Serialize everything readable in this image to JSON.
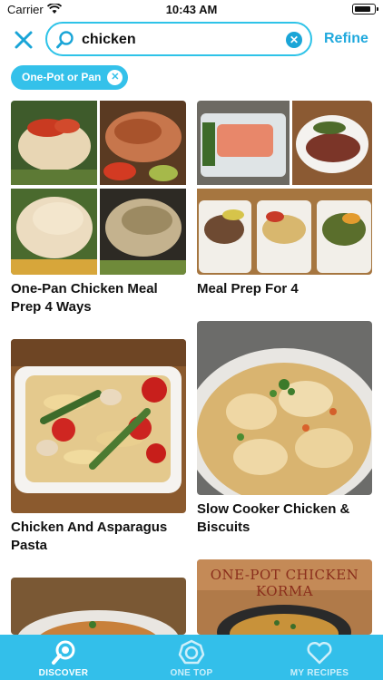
{
  "status_bar": {
    "carrier": "Carrier",
    "time": "10:43 AM"
  },
  "search": {
    "query": "chicken",
    "refine_label": "Refine"
  },
  "filter_chip": {
    "label": "One-Pot or Pan"
  },
  "recipes": [
    {
      "title": "One-Pan Chicken Meal Prep 4 Ways"
    },
    {
      "title": "Meal Prep For 4"
    },
    {
      "title": "Chicken And Asparagus Pasta"
    },
    {
      "title": "Slow Cooker Chicken & Biscuits"
    },
    {
      "title": ""
    },
    {
      "title": ""
    }
  ],
  "korma_banner_text": "ONE-POT CHICKEN KORMA",
  "tabs": [
    {
      "label": "DISCOVER",
      "icon": "discover-icon"
    },
    {
      "label": "ONE TOP",
      "icon": "one-top-icon"
    },
    {
      "label": "MY RECIPES",
      "icon": "heart-icon"
    }
  ],
  "colors": {
    "accent": "#33bfea",
    "refine": "#21a9dd"
  }
}
